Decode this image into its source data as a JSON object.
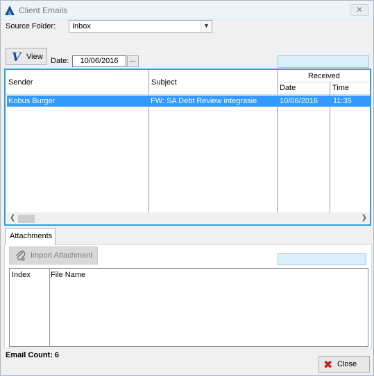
{
  "window": {
    "title": "Client Emails",
    "close_glyph": "✕"
  },
  "filters": {
    "source_folder_label": "Source Folder:",
    "source_folder_value": "Inbox",
    "view_label": "View",
    "date_label": "Date:",
    "date_value": "10/06/2016",
    "date_picker_label": "..."
  },
  "emails": {
    "columns": {
      "sender": "Sender",
      "subject": "Subject",
      "received_group": "Received",
      "date": "Date",
      "time": "Time"
    },
    "rows": [
      {
        "sender": "Kobus Burger",
        "subject": "FW: SA Debt Review integrasie",
        "date": "10/06/2016",
        "time": "11:35",
        "selected": true
      }
    ]
  },
  "attachments": {
    "tab_label": "Attachments",
    "import_label": "Import Attachment",
    "columns": {
      "index": "Index",
      "file_name": "File Name"
    }
  },
  "footer": {
    "email_count_label": "Email Count: 6",
    "close_label": "Close"
  },
  "icons": {
    "app": "app-logo-icon",
    "view": "view-check-icon",
    "import": "paperclip-icon",
    "close": "red-x-icon"
  },
  "colors": {
    "selection": "#3399ff",
    "grid_focus_border": "#2e9fd8",
    "progress_fill": "#dbeefc",
    "close_icon": "#d01818"
  }
}
